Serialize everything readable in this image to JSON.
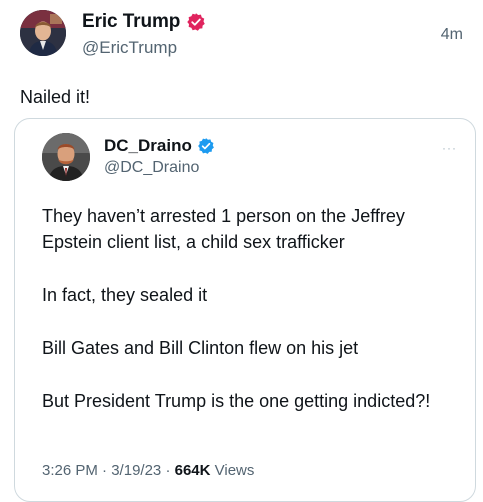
{
  "outer_post": {
    "display_name": "Eric Trump",
    "handle": "@EricTrump",
    "time_ago": "4m",
    "text": "Nailed it!",
    "badge_color": "#e0245e"
  },
  "quoted_post": {
    "display_name": "DC_Draino",
    "handle": "@DC_Draino",
    "badge_color": "#1d9bf0",
    "more_icon": "···",
    "paragraphs": [
      "They haven’t arrested 1 person on the Jeffrey Epstein client list, a child sex trafficker",
      "In fact, they sealed it",
      "Bill Gates and Bill Clinton flew on his jet",
      "But President Trump is the one getting indicted?!"
    ],
    "time": "3:26 PM",
    "date": "3/19/23",
    "separator": "·",
    "views_count": "664K",
    "views_label": "Views"
  }
}
